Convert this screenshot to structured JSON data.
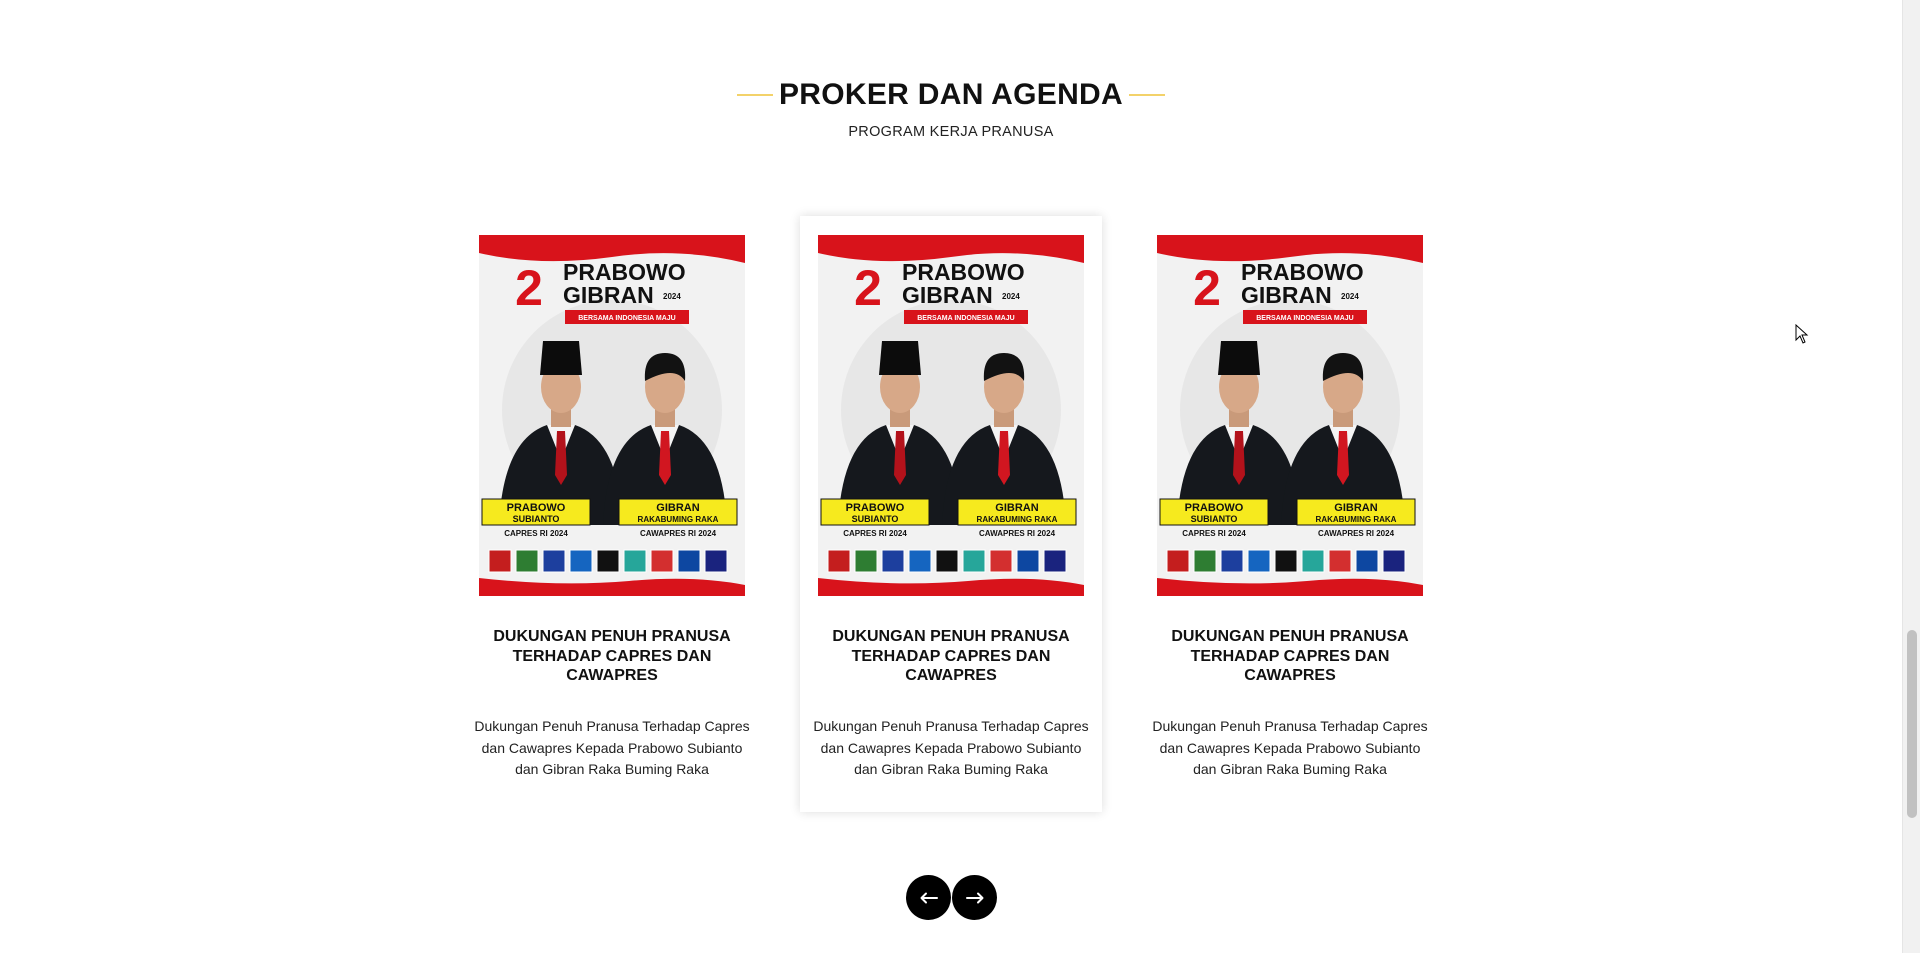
{
  "section": {
    "title": "PROKER DAN AGENDA",
    "subtitle": "PROGRAM KERJA PRANUSA",
    "accent_color": "#f3d26a"
  },
  "cards": [
    {
      "title": "DUKUNGAN PENUH PRANUSA TERHADAP CAPRES DAN CAWAPRES",
      "description": "Dukungan Penuh Pranusa Terhadap Capres dan Cawapres Kepada Prabowo Subianto dan Gibran Raka Buming Raka",
      "active": false
    },
    {
      "title": "DUKUNGAN PENUH PRANUSA TERHADAP CAPRES DAN CAWAPRES",
      "description": "Dukungan Penuh Pranusa Terhadap Capres dan Cawapres Kepada Prabowo Subianto dan Gibran Raka Buming Raka",
      "active": true
    },
    {
      "title": "DUKUNGAN PENUH PRANUSA TERHADAP CAPRES DAN CAWAPRES",
      "description": "Dukungan Penuh Pranusa Terhadap Capres dan Cawapres Kepada Prabowo Subianto dan Gibran Raka Buming Raka",
      "active": false
    }
  ],
  "poster": {
    "number": "2",
    "name_line1": "PRABOWO",
    "name_line2": "GIBRAN",
    "year": "2024",
    "tagline": "BERSAMA INDONESIA MAJU",
    "left_name1": "PRABOWO",
    "left_name2": "SUBIANTO",
    "left_role": "CAPRES RI 2024",
    "right_name1": "GIBRAN",
    "right_name2": "RAKABUMING RAKA",
    "right_role": "CAWAPRES RI 2024",
    "red": "#d8131b",
    "yellow": "#f6ea1e"
  },
  "nav": {
    "prev_icon": "arrow-left-icon",
    "next_icon": "arrow-right-icon"
  }
}
